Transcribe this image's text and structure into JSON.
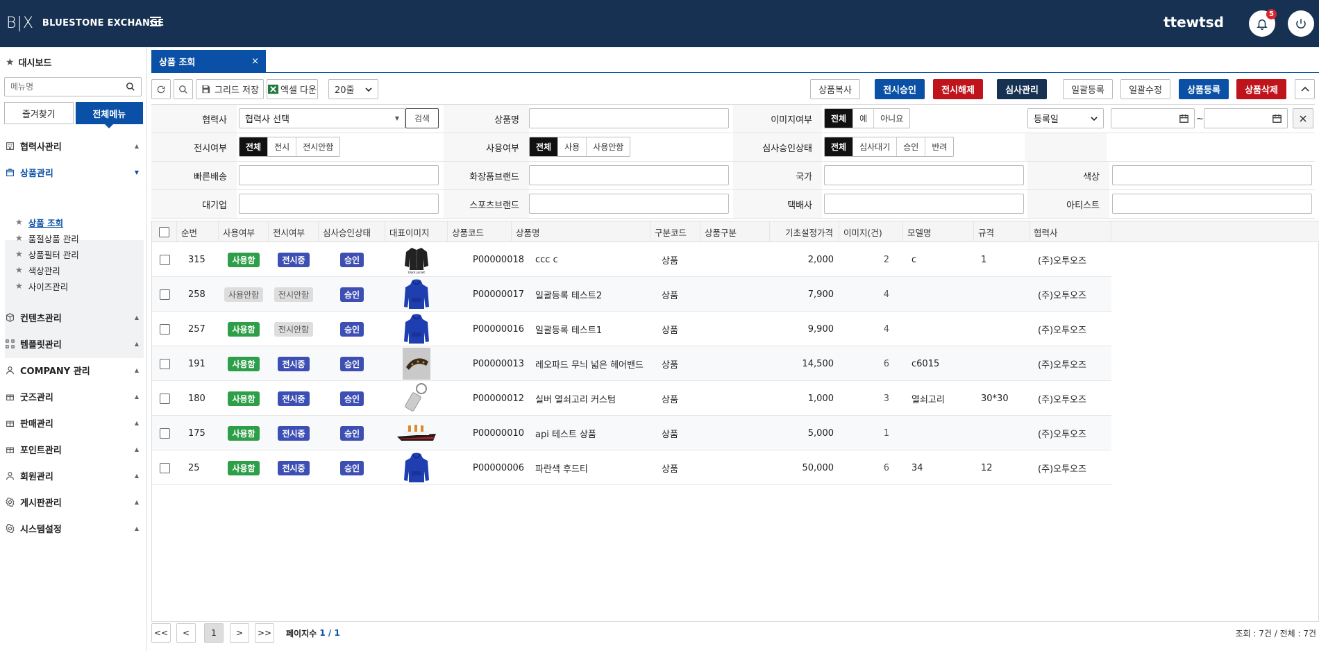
{
  "header": {
    "logo_mark": "B|X",
    "logo_text": "BLUESTONE EXCHANGE",
    "username": "ttewtsd",
    "notification_count": "5"
  },
  "sidebar": {
    "dashboard": "대시보드",
    "search_placeholder": "메뉴명",
    "tab_favorites": "즐겨찾기",
    "tab_all": "전체메뉴",
    "nav": [
      {
        "label": "협력사관리",
        "icon": "building-icon"
      },
      {
        "label": "상품관리",
        "icon": "box-icon",
        "active": true
      },
      {
        "label": "컨텐츠관리",
        "icon": "cube-icon"
      },
      {
        "label": "템플릿관리",
        "icon": "template-icon"
      },
      {
        "label": "COMPANY 관리",
        "icon": "person-icon"
      },
      {
        "label": "굿즈관리",
        "icon": "gift-icon"
      },
      {
        "label": "판매관리",
        "icon": "gift-icon"
      },
      {
        "label": "포인트관리",
        "icon": "gift-icon"
      },
      {
        "label": "회원관리",
        "icon": "person-icon"
      },
      {
        "label": "게시판관리",
        "icon": "gear-icon"
      },
      {
        "label": "시스템설정",
        "icon": "gear-icon"
      }
    ],
    "sub": [
      {
        "label": "상품 조회",
        "active": true
      },
      {
        "label": "품절상품 관리"
      },
      {
        "label": "상품필터 관리"
      },
      {
        "label": "색상관리"
      },
      {
        "label": "사이즈관리"
      }
    ]
  },
  "page_tab": {
    "label": "상품 조회",
    "close": "×"
  },
  "toolbar": {
    "grid_save": "그리드 저장",
    "excel_down": "엑셀 다운",
    "page_size": "20줄",
    "copy": "상품복사",
    "display_approve": "전시승인",
    "display_release": "전시해제",
    "review_manage": "심사관리",
    "bulk_register": "일괄등록",
    "bulk_edit": "일괄수정",
    "product_register": "상품등록",
    "product_delete": "상품삭제"
  },
  "filters": {
    "partner_label": "협력사",
    "partner_select": "협력사 선택",
    "partner_search": "검색",
    "product_name_label": "상품명",
    "image_label": "이미지여부",
    "image_options": [
      "전체",
      "예",
      "아니요"
    ],
    "date_type": "등록일",
    "date_sep": "~",
    "display_label": "전시여부",
    "display_options": [
      "전체",
      "전시",
      "전시안함"
    ],
    "use_label": "사용여부",
    "use_options": [
      "전체",
      "사용",
      "사용안함"
    ],
    "review_label": "심사승인상태",
    "review_options": [
      "전체",
      "심사대기",
      "승인",
      "반려"
    ],
    "fast_delivery_label": "빠른배송",
    "cosmetic_brand_label": "화장품브랜드",
    "country_label": "국가",
    "color_label": "색상",
    "enterprise_label": "대기업",
    "sports_brand_label": "스포츠브랜드",
    "courier_label": "택배사",
    "artist_label": "아티스트"
  },
  "table": {
    "columns": [
      "순번",
      "사용여부",
      "전시여부",
      "심사승인상태",
      "대표이미지",
      "상품코드",
      "상품명",
      "구분코드",
      "상품구분",
      "기초설정가격",
      "이미지(건)",
      "모델명",
      "규격",
      "협력사"
    ],
    "rows": [
      {
        "no": "315",
        "use": "사용함",
        "use_on": true,
        "display": "전시중",
        "display_on": true,
        "review": "승인",
        "image": "jacket",
        "code": "P00000018",
        "name": "ccc c",
        "type": "상품",
        "price": "2,000",
        "images": "2",
        "model": "c",
        "spec": "1",
        "partner": "(주)오투오즈"
      },
      {
        "no": "258",
        "use": "사용안함",
        "use_on": false,
        "display": "전시안함",
        "display_on": false,
        "review": "승인",
        "image": "hoodie",
        "code": "P00000017",
        "name": "일괄등록 테스트2",
        "type": "상품",
        "price": "7,900",
        "images": "4",
        "model": "",
        "spec": "",
        "partner": "(주)오투오즈"
      },
      {
        "no": "257",
        "use": "사용함",
        "use_on": true,
        "display": "전시안함",
        "display_on": false,
        "review": "승인",
        "image": "hoodie",
        "code": "P00000016",
        "name": "일괄등록 테스트1",
        "type": "상품",
        "price": "9,900",
        "images": "4",
        "model": "",
        "spec": "",
        "partner": "(주)오투오즈"
      },
      {
        "no": "191",
        "use": "사용함",
        "use_on": true,
        "display": "전시중",
        "display_on": true,
        "review": "승인",
        "image": "headband",
        "code": "P00000013",
        "name": "레오파드 무늬 넓은 헤어밴드",
        "type": "상품",
        "price": "14,500",
        "images": "6",
        "model": "c6015",
        "spec": "",
        "partner": "(주)오투오즈"
      },
      {
        "no": "180",
        "use": "사용함",
        "use_on": true,
        "display": "전시중",
        "display_on": true,
        "review": "승인",
        "image": "keyring",
        "code": "P00000012",
        "name": "실버 열쇠고리 커스텀",
        "type": "상품",
        "price": "1,000",
        "images": "3",
        "model": "열쇠고리",
        "spec": "30*30",
        "partner": "(주)오투오즈"
      },
      {
        "no": "175",
        "use": "사용함",
        "use_on": true,
        "display": "전시중",
        "display_on": true,
        "review": "승인",
        "image": "ship",
        "code": "P00000010",
        "name": "api 테스트 상품",
        "type": "상품",
        "price": "5,000",
        "images": "1",
        "model": "",
        "spec": "",
        "partner": "(주)오투오즈"
      },
      {
        "no": "25",
        "use": "사용함",
        "use_on": true,
        "display": "전시중",
        "display_on": true,
        "review": "승인",
        "image": "hoodie",
        "code": "P00000006",
        "name": "파란색 후드티",
        "type": "상품",
        "price": "50,000",
        "images": "6",
        "model": "34",
        "spec": "12",
        "partner": "(주)오투오즈"
      }
    ]
  },
  "pager": {
    "first": "<<",
    "prev": "<",
    "current": "1",
    "next": ">",
    "last": ">>",
    "pages_label": "페이지수",
    "pages_value": "1 / 1",
    "summary": "조회 : 7건 / 전체 : 7건"
  },
  "colors": {
    "navy": "#163151",
    "primary": "#0a50a6",
    "danger": "#c0141c",
    "green": "#2e9e48",
    "indigo": "#3d4fb3"
  }
}
